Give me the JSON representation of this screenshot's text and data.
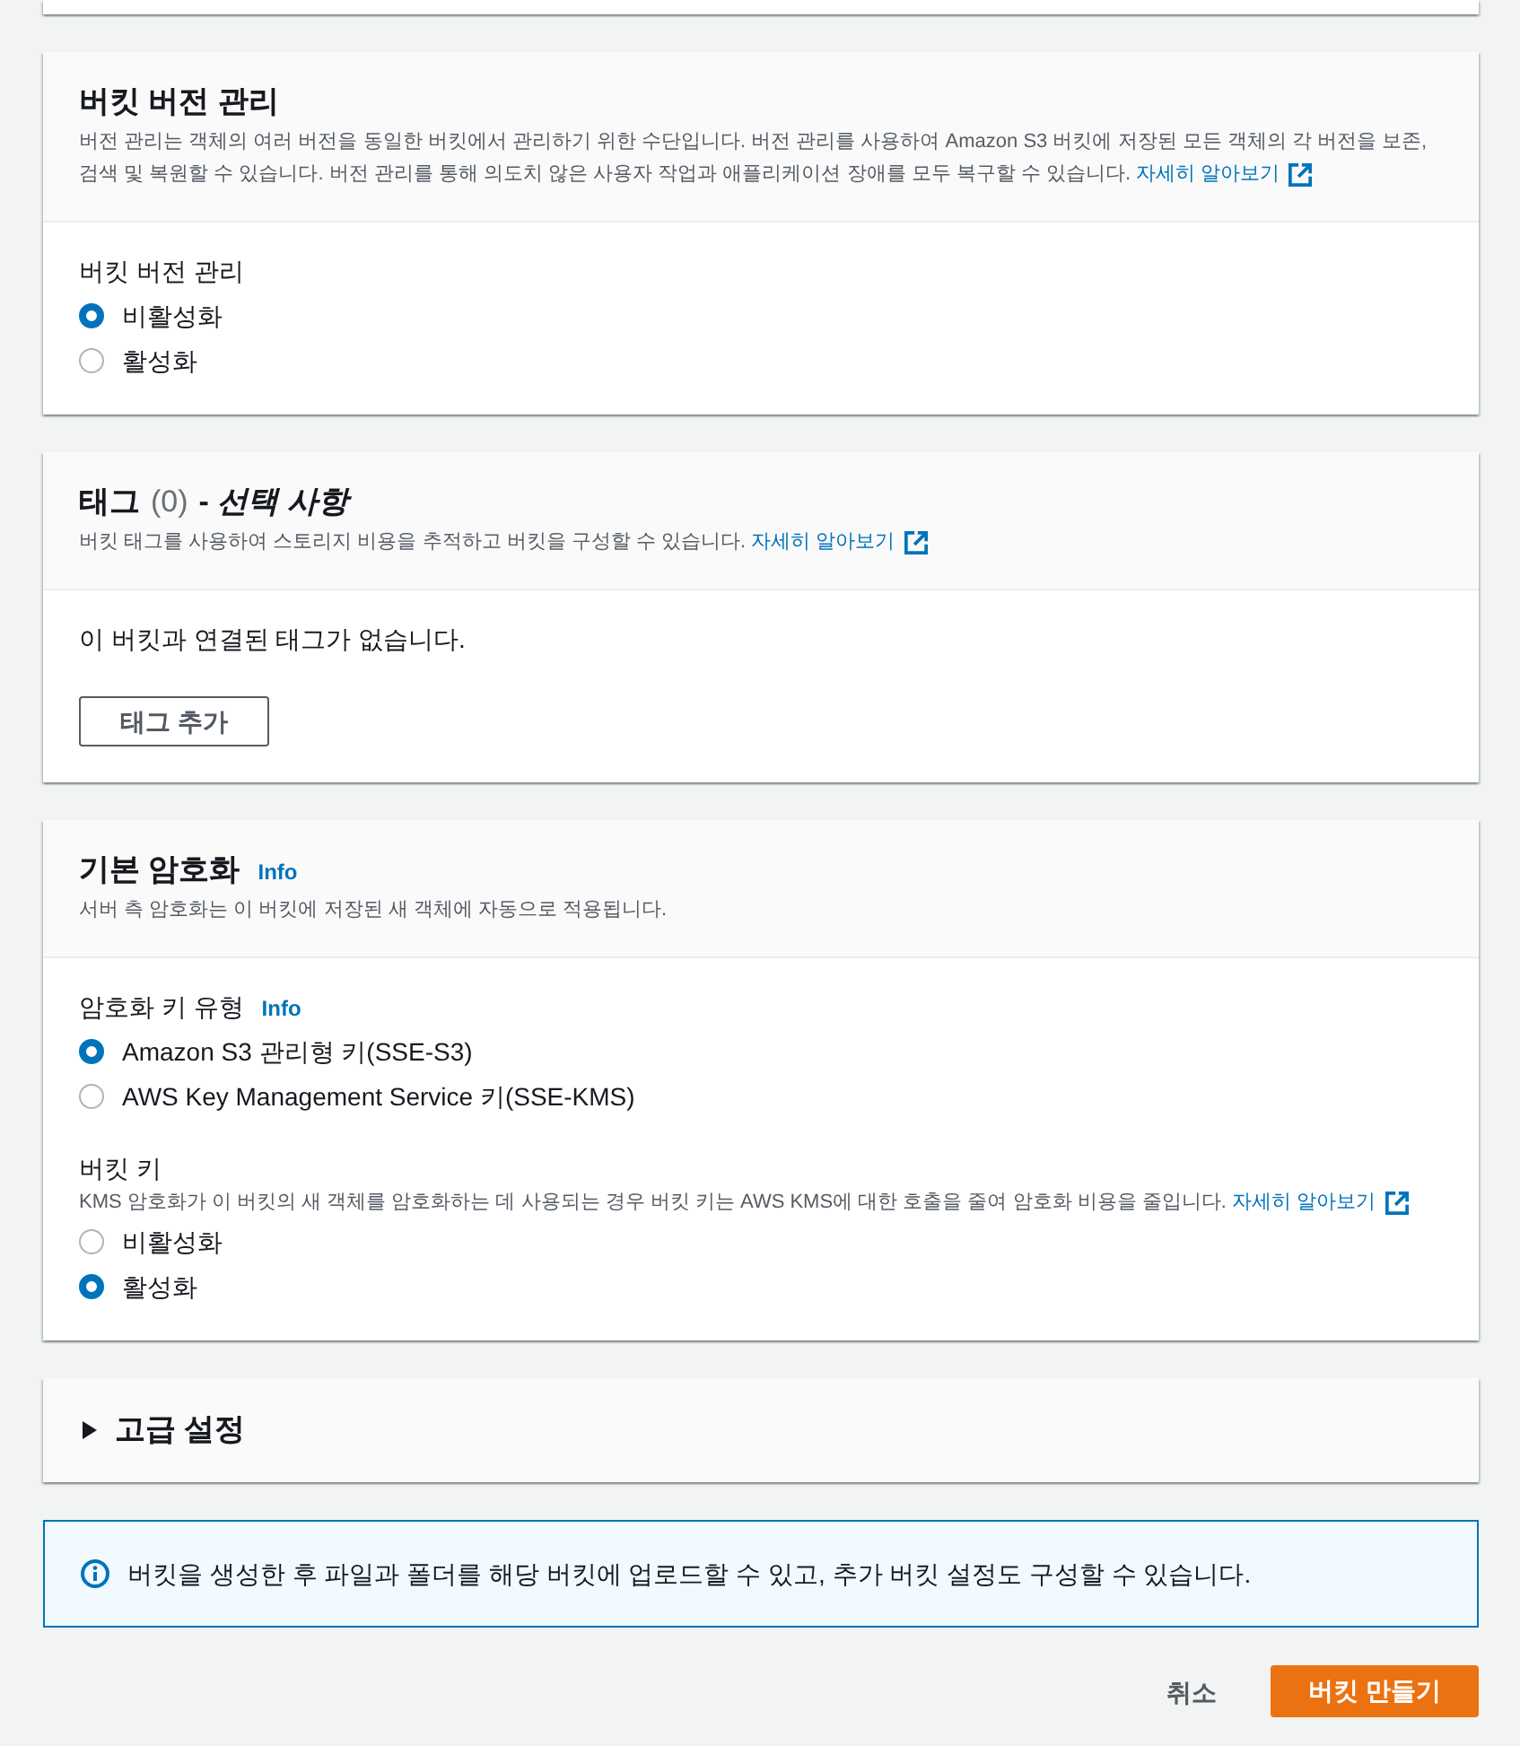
{
  "sections": [
    {
      "kind": "form",
      "title": "버킷 버전 관리",
      "description": "버전 관리는 객체의 여러 버전을 동일한 버킷에서 관리하기 위한 수단입니다. 버전 관리를 사용하여 Amazon S3 버킷에 저장된 모든 객체의 각 버전을 보존, 검색 및 복원할 수 있습니다. 버전 관리를 통해 의도치 않은 사용자 작업과 애플리케이션 장애를 모두 복구할 수 있습니다.",
      "link": "자세히 알아보기",
      "fields": [
        {
          "label": "버킷 버전 관리",
          "options": [
            {
              "label": "비활성화",
              "selected": true
            },
            {
              "label": "활성화",
              "selected": false
            }
          ]
        }
      ]
    },
    {
      "kind": "list",
      "title": "태그",
      "counter": "(0)",
      "title_note": "- *선택 사항*",
      "description": "버킷 태그를 사용하여 스토리지 비용을 추적하고 버킷을 구성할 수 있습니다.",
      "link": "자세히 알아보기",
      "empty_message": "이 버킷과 연결된 태그가 없습니다.",
      "button": "태그 추가"
    },
    {
      "kind": "form",
      "title": "기본 암호화",
      "info": "Info",
      "description": "서버 측 암호화는 이 버킷에 저장된 새 객체에 자동으로 적용됩니다.",
      "fields": [
        {
          "label": "암호화 키 유형",
          "info": "Info",
          "options": [
            {
              "label": "Amazon S3 관리형 키(SSE-S3)",
              "selected": true
            },
            {
              "label": "AWS Key Management Service 키(SSE-KMS)",
              "selected": false
            }
          ]
        },
        {
          "label": "버킷 키",
          "description": "KMS 암호화가 이 버킷의 새 객체를 암호화하는 데 사용되는 경우 버킷 키는 AWS KMS에 대한 호출을 줄여 암호화 비용을 줄입니다.",
          "link": "자세히 알아보기",
          "options": [
            {
              "label": "비활성화",
              "selected": false
            },
            {
              "label": "활성화",
              "selected": true
            }
          ]
        }
      ]
    },
    {
      "kind": "expandable",
      "title": "고급 설정",
      "expanded": false
    }
  ],
  "alert": {
    "text": "버킷을 생성한 후 파일과 폴더를 해당 버킷에 업로드할 수 있고, 추가 버킷 설정도 구성할 수 있습니다."
  },
  "actions": [
    {
      "kind": "link",
      "label": "취소"
    },
    {
      "kind": "primary",
      "label": "버킷 만들기"
    }
  ]
}
